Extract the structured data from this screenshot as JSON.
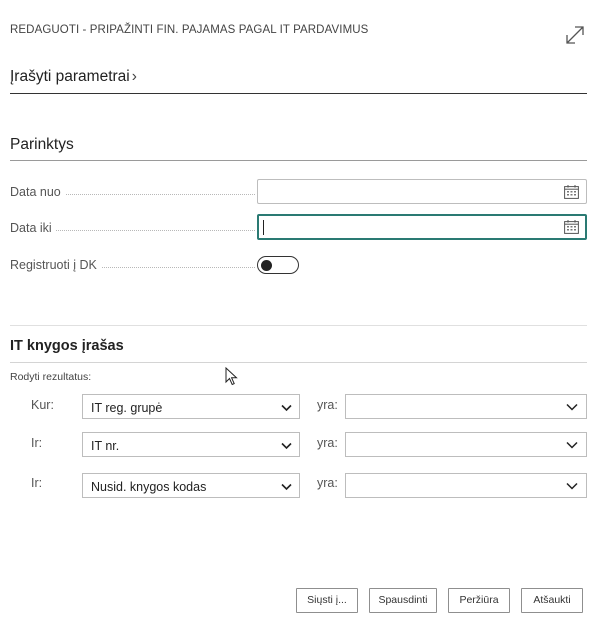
{
  "dialog": {
    "title": "REDAGUOTI - PRIPAŽINTI FIN. PAJAMAS PAGAL IT PARDAVIMUS",
    "expand_icon": "expand-diagonal-arrow-icon"
  },
  "saved_params": {
    "label": "Įrašyti parametrai",
    "chevron": "›"
  },
  "options": {
    "header": "Parinktys",
    "date_from": {
      "label": "Data nuo",
      "value": "",
      "icon": "calendar-icon"
    },
    "date_to": {
      "label": "Data iki",
      "value": "",
      "icon": "calendar-icon",
      "focused": true
    },
    "post_to_gl": {
      "label": "Registruoti į DK",
      "checked": false
    }
  },
  "entry": {
    "header": "IT knygos įrašas",
    "show_results": "Rodyti rezultatus:",
    "filters": [
      {
        "prefix": "Kur:",
        "field": "IT reg. grupė",
        "op": "yra:",
        "value": ""
      },
      {
        "prefix": "Ir:",
        "field": "IT nr.",
        "op": "yra:",
        "value": ""
      },
      {
        "prefix": "Ir:",
        "field": "Nusid. knygos kodas",
        "op": "yra:",
        "value": ""
      }
    ]
  },
  "buttons": {
    "send_to": "Siųsti į...",
    "print": "Spausdinti",
    "preview": "Peržiūra",
    "cancel": "Atšaukti"
  },
  "colors": {
    "focus_border": "#2a7a73",
    "border": "#bdbdbd",
    "text": "#333333"
  }
}
